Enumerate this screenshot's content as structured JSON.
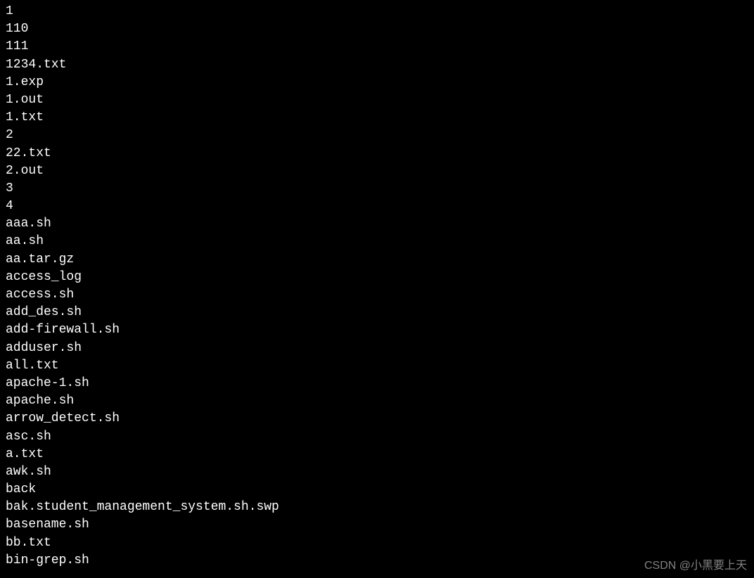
{
  "terminal": {
    "lines": [
      "1",
      "110",
      "111",
      "1234.txt",
      "1.exp",
      "1.out",
      "1.txt",
      "2",
      "22.txt",
      "2.out",
      "3",
      "4",
      "aaa.sh",
      "aa.sh",
      "aa.tar.gz",
      "access_log",
      "access.sh",
      "add_des.sh",
      "add-firewall.sh",
      "adduser.sh",
      "all.txt",
      "apache-1.sh",
      "apache.sh",
      "arrow_detect.sh",
      "asc.sh",
      "a.txt",
      "awk.sh",
      "back",
      "bak.student_management_system.sh.swp",
      "basename.sh",
      "bb.txt",
      "bin-grep.sh"
    ]
  },
  "watermark": {
    "text": "CSDN @小黑要上天"
  }
}
